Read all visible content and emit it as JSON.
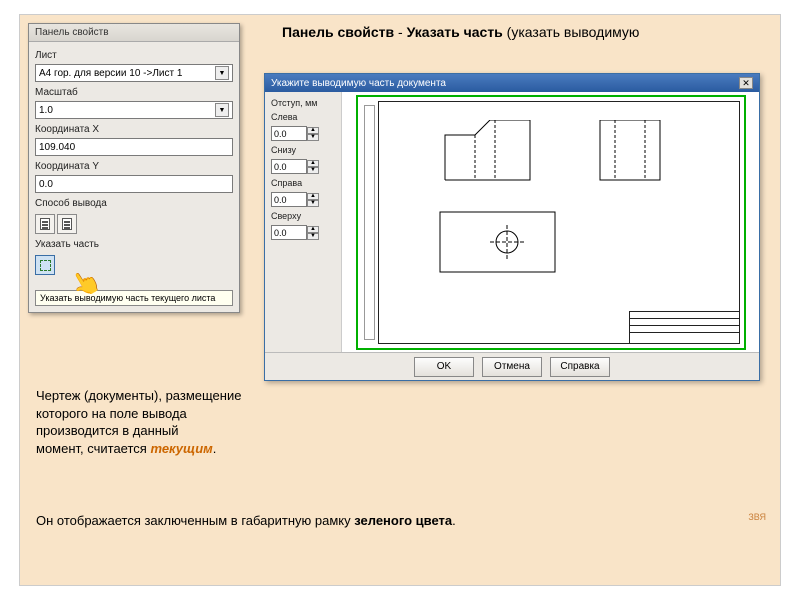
{
  "props_panel": {
    "title": "Панель свойств",
    "fields": {
      "sheet_label": "Лист",
      "sheet_value": "A4 гор. для версии 10 ->Лист 1",
      "scale_label": "Масштаб",
      "scale_value": "1.0",
      "coordx_label": "Координата X",
      "coordx_value": "109.040",
      "coordy_label": "Координата Y",
      "coordy_value": "0.0",
      "output_label": "Способ вывода",
      "part_label": "Указать часть"
    },
    "tooltip": "Указать выводимую часть текущего листа"
  },
  "heading": {
    "part1": "Панель свойств",
    "dash": " - ",
    "part2": "Указать часть",
    "tail": " (указать выводимую"
  },
  "dialog": {
    "title": "Укажите выводимую часть документа",
    "group_label": "Отступ, мм",
    "fields": {
      "left_label": "Слева",
      "left_val": "0.0",
      "bottom_label": "Снизу",
      "bottom_val": "0.0",
      "right_label": "Справа",
      "right_val": "0.0",
      "top_label": "Сверху",
      "top_val": "0.0"
    },
    "buttons": {
      "ok": "OK",
      "cancel": "Отмена",
      "help": "Справка"
    }
  },
  "body": {
    "p1a": "Чертеж (документы), размещение которого на поле вывода производится в данный ",
    "p1b": "момент, считается ",
    "p1c": "текущим",
    "p1d": ".",
    "p2a": "Он отображается заключенным в габаритную рамку ",
    "p2b": "зеленого цвета",
    "p2c": "."
  },
  "author": "ЗВЯ"
}
